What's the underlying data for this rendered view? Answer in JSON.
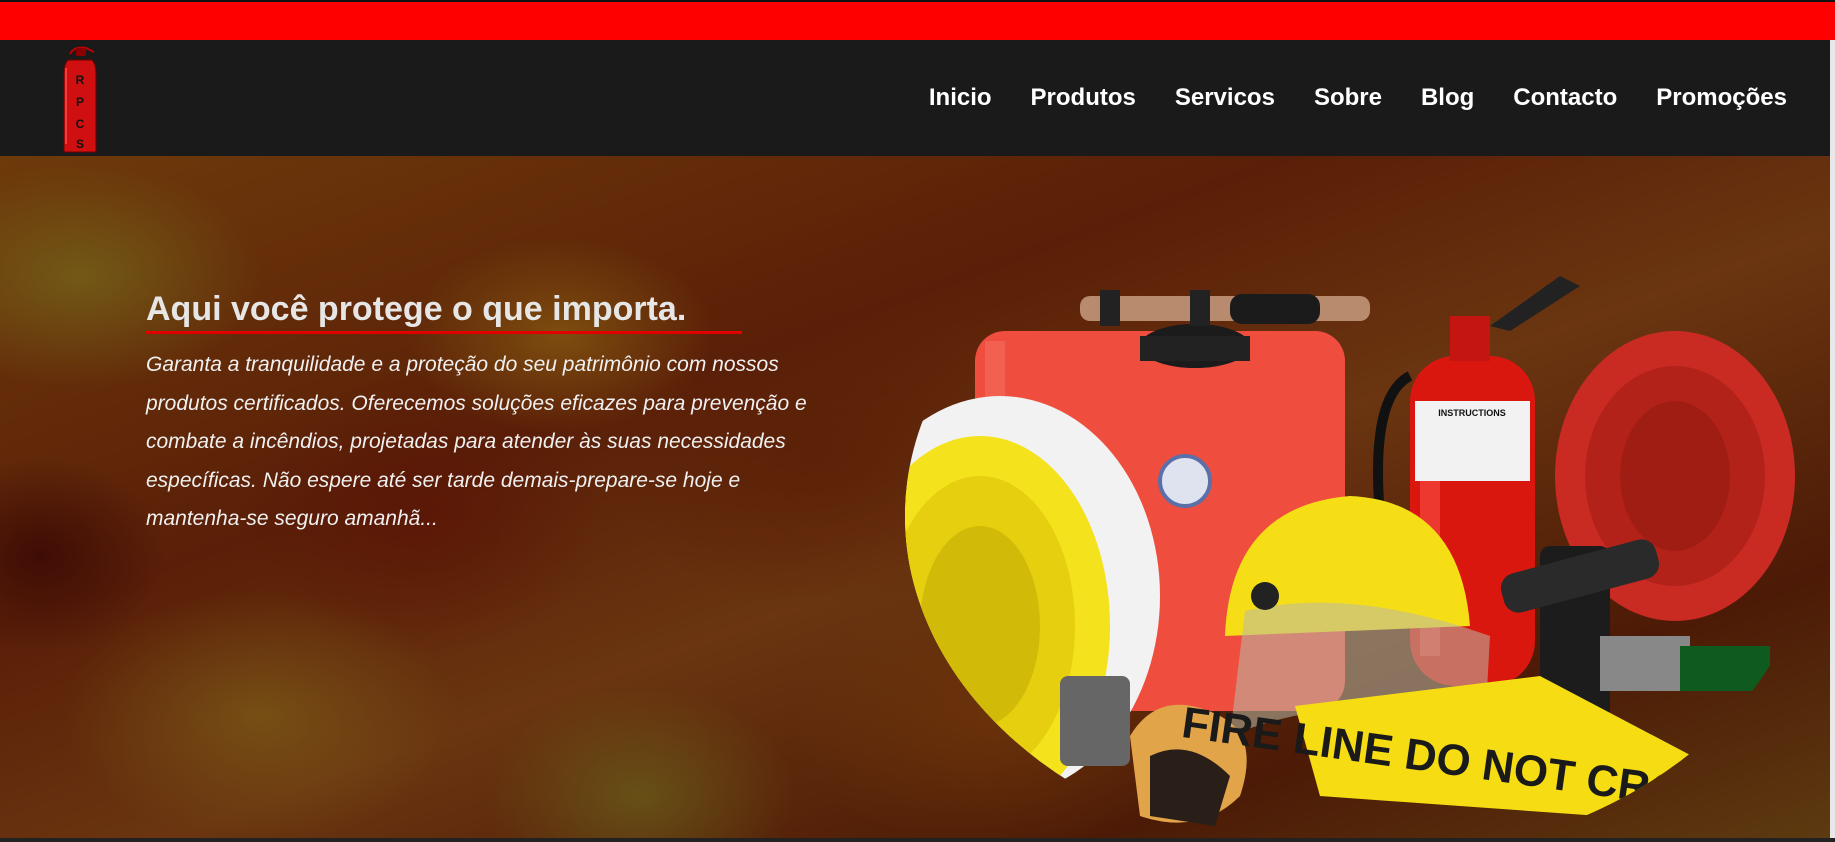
{
  "brand": {
    "logo_letters": [
      "R",
      "P",
      "C",
      "S"
    ],
    "accent_color": "#ff0000",
    "nav_bg": "#1a1a1a"
  },
  "nav": {
    "links": [
      {
        "label": "Inicio"
      },
      {
        "label": "Produtos"
      },
      {
        "label": "Servicos"
      },
      {
        "label": "Sobre"
      },
      {
        "label": "Blog"
      },
      {
        "label": "Contacto"
      },
      {
        "label": "Promoções"
      }
    ]
  },
  "hero": {
    "title": "Aqui você protege o que importa.",
    "lines": [
      "Garanta a tranquilidade e a proteção do seu patrimônio com nossos",
      "produtos certificados. Oferecemos soluções eficazes para prevenção e",
      "combate a incêndios, projetadas para atender às suas necessidades",
      "específicas. Não espere até ser tarde demais-prepare-se hoje e",
      "mantenha-se seguro amanhã..."
    ],
    "image_tape_text": "FIRE LINE DO NOT CROSS",
    "image_label": "INSTRUCTIONS"
  }
}
